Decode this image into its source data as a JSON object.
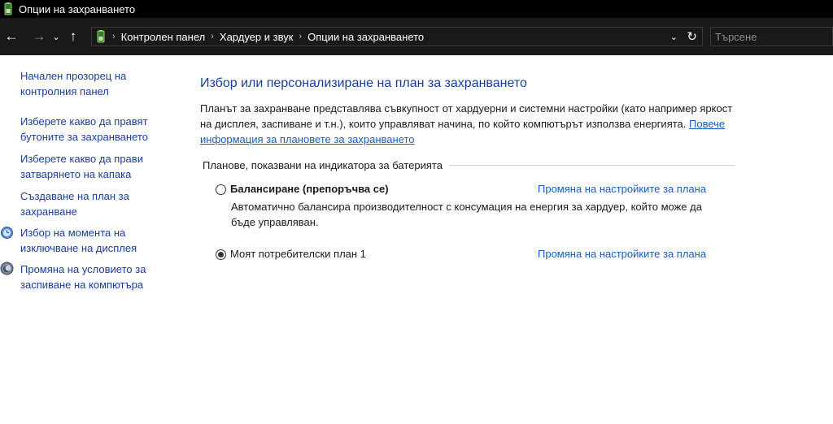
{
  "window": {
    "title": "Опции на захранването"
  },
  "address_bar": {
    "crumbs": [
      "Контролен панел",
      "Хардуер и звук",
      "Опции на захранването"
    ]
  },
  "search": {
    "placeholder": "Търсене"
  },
  "left_pane": {
    "links": [
      "Начален прозорец на контролния панел",
      "Изберете какво да правят бутоните за захранването",
      "Изберете какво да прави затварянето на капака",
      "Създаване на план за захранване",
      "Избор на момента на изключване на дисплея",
      "Промяна на условието за заспиване на компютъра"
    ]
  },
  "main": {
    "heading": "Избор или персонализиране на план за захранването",
    "description": "Планът за захранване представлява съвкупност от хардуерни и системни настройки  (като например яркост на дисплея, заспиване и т.н.), които управляват начина, по който компютърът използва енергията. ",
    "more_info_link": "Повече информация за плановете за захранването",
    "group_label": "Планове, показвани на индикатора за батерията",
    "plans": [
      {
        "name": "Балансиране (препоръчва се)",
        "description": "Автоматично балансира производителност с консумация на енергия за хардуер, който може да бъде управляван.",
        "selected": false,
        "link": "Промяна на настройките за плана"
      },
      {
        "name": "Моят потребителски план 1",
        "selected": true,
        "link": "Промяна на настройките за плана"
      }
    ]
  },
  "icons": {
    "back": "arrow-left-icon",
    "forward": "arrow-right-icon",
    "recent": "chevron-down-icon",
    "up": "arrow-up-icon",
    "location": "power-options-icon",
    "refresh": "refresh-icon",
    "display": "display-timer-icon",
    "sleep": "sleep-moon-icon"
  },
  "colors": {
    "link": "#1a3d99",
    "heading": "#1a3d99",
    "titlebar": "#000000",
    "navbar": "#191919"
  }
}
